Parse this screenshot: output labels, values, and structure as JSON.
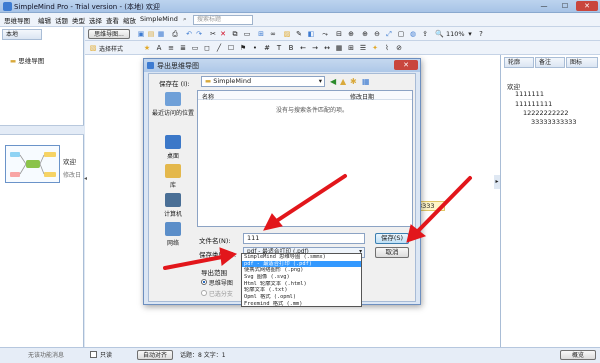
{
  "window": {
    "title": "SimpleMind Pro - Trial version - (本地) 欢迎",
    "min": "—",
    "max": "☐",
    "close": "✕"
  },
  "menu": {
    "items": [
      "思维导图",
      "编辑",
      "话题",
      "类型",
      "选择",
      "查看",
      "缩放",
      "SimpleMind"
    ],
    "search_placeholder": "搜索标题"
  },
  "left_pane": {
    "tab": "本地",
    "tree_item": "思维导图",
    "thumb_title": "欢迎",
    "thumb_sub": "修改日"
  },
  "toolbar": {
    "map_button": "思维导图...",
    "style_button": "选择样式",
    "zoom": "110%"
  },
  "right_pane": {
    "tabs": [
      "轮廓",
      "备注",
      "图标"
    ],
    "outline": [
      "欢迎",
      "1111111",
      "111111111",
      "12222222222",
      "33333333333"
    ]
  },
  "canvas": {
    "node_fragment": "3333"
  },
  "status": {
    "left": "无该功能消息",
    "only_label": "只读",
    "layout": "自动对齐",
    "topics": "话题：8 文字：1",
    "right": "概览"
  },
  "dialog": {
    "title": "导出思维导图",
    "save_in_label": "保存在 (I):",
    "save_in_value": "SimpleMind",
    "places": [
      "最近访问的位置",
      "桌面",
      "库",
      "计算机",
      "网络"
    ],
    "col_name": "名称",
    "col_date": "修改日期",
    "empty_msg": "没有与搜索条件匹配的项。",
    "filename_label": "文件名(N):",
    "filename_value": "111",
    "filetype_label": "保存类型(T):",
    "filetype_value": "pdf - 最适合打印 (.pdf)",
    "export_range_label": "导出范围",
    "radio1": "思维导图",
    "radio2": "已选分支",
    "save_btn": "保存(S)",
    "cancel_btn": "取消"
  },
  "filetype_options": [
    "SimpleMind 思维导图 (.smmx)",
    "pdf - 最适合打印 (.pdf)",
    "便携式网络图形 (.png)",
    "Svg 图像 (.svg)",
    "Html 轮廓文本 (.html)",
    "轮廓文本 (.txt)",
    "Opml 格式 (.opml)",
    "Freemind 格式 (.mm)"
  ],
  "colors": {
    "accent": "#3399ff",
    "arrow": "#e2161b",
    "node_green": "#8bc34a"
  }
}
